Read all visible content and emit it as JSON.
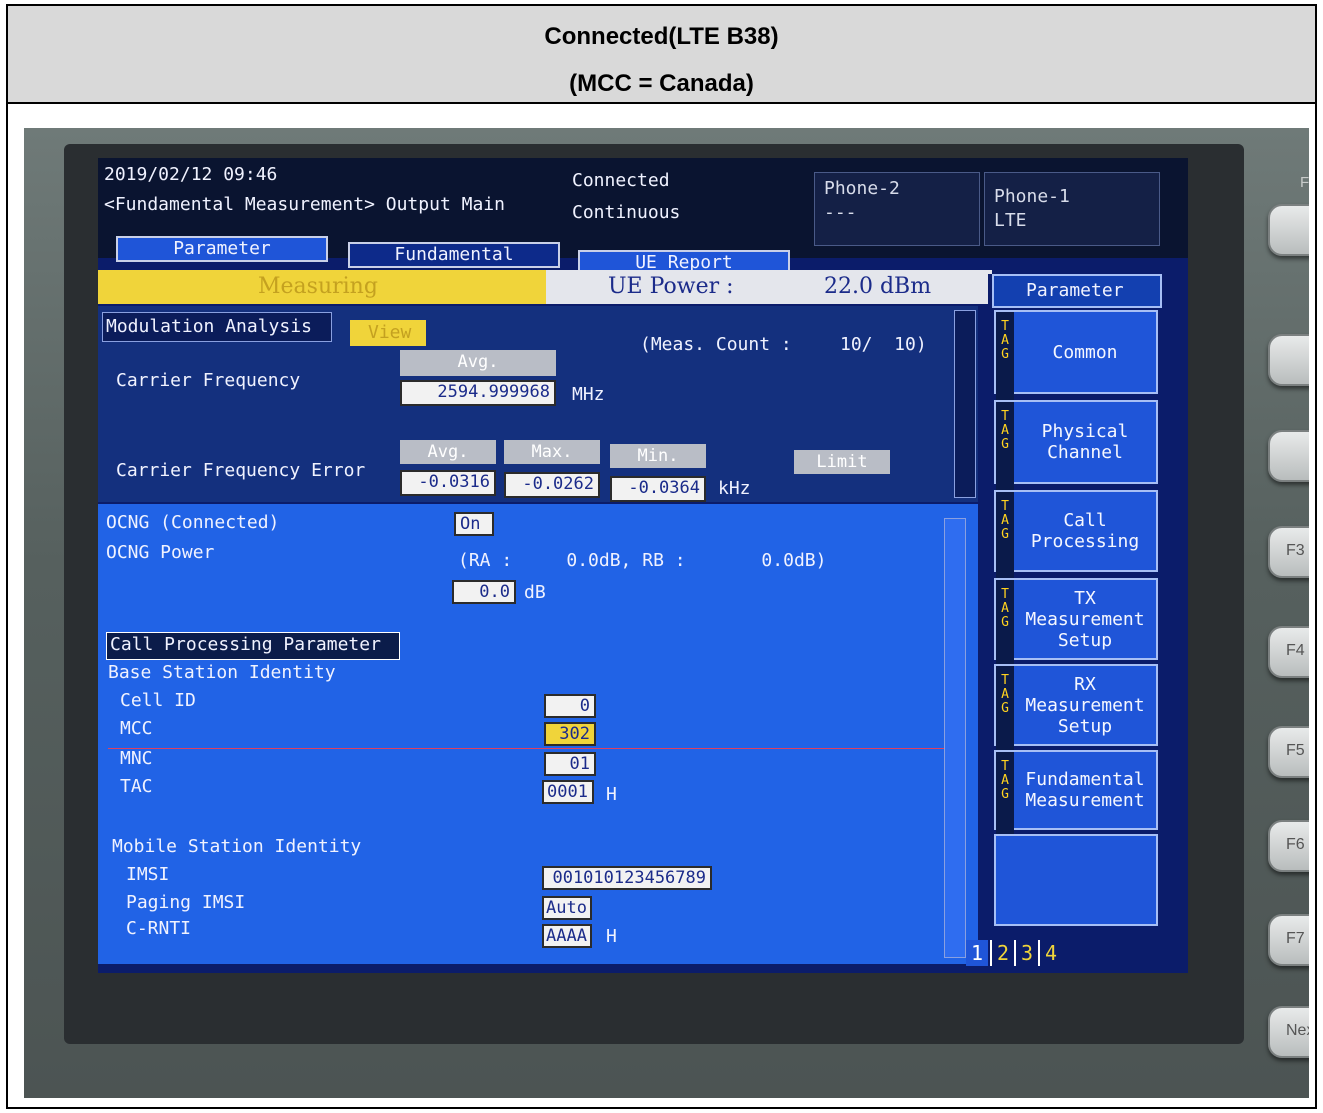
{
  "caption": {
    "title": "Connected(LTE B38)",
    "subtitle": "(MCC = Canada)"
  },
  "screen": {
    "datetime": "2019/02/12 09:46",
    "mode": "<Fundamental Measurement> Output Main",
    "call_status": "Connected",
    "sweep": "Continuous",
    "phone2": {
      "label": "Phone-2",
      "status": "---"
    },
    "phone1": {
      "label": "Phone-1",
      "status": "LTE"
    },
    "tabs": [
      "Parameter",
      "Fundamental",
      "UE Report"
    ],
    "measuring": "Measuring",
    "ue_power": {
      "label": "UE Power :",
      "value": "22.0 dBm"
    },
    "modulation_title": "Modulation Analysis",
    "view_button": "View",
    "meas_count": "(Meas. Count :",
    "meas_count_value": "10/  10)",
    "carrier_freq": {
      "label": "Carrier Frequency",
      "avg_label": "Avg.",
      "value": "2594.999968",
      "unit": "MHz"
    },
    "carrier_err": {
      "label": "Carrier Frequency Error",
      "avg_label": "Avg.",
      "max_label": "Max.",
      "min_label": "Min.",
      "avg": "-0.0316",
      "max": "-0.0262",
      "min": "-0.0364",
      "unit": "kHz",
      "limit_button": "Limit"
    },
    "ocng": {
      "label": "OCNG (Connected)",
      "value": "On",
      "power_label": "OCNG Power",
      "power_detail": "(RA :     0.0dB, RB :       0.0dB)",
      "power_value": "0.0",
      "power_unit": "dB"
    },
    "call_proc_header": "Call Processing Parameter",
    "bs_identity": "Base Station Identity",
    "cell_id": {
      "label": "Cell ID",
      "value": "0"
    },
    "mcc": {
      "label": "MCC",
      "value": "302"
    },
    "mnc": {
      "label": "MNC",
      "value": "01"
    },
    "tac": {
      "label": "TAC",
      "value": "0001",
      "unit": "H"
    },
    "ms_identity": "Mobile Station Identity",
    "imsi": {
      "label": "IMSI",
      "value": "001010123456789"
    },
    "paging_imsi": {
      "label": "Paging IMSI",
      "value": "Auto"
    },
    "crnti": {
      "label": "C-RNTI",
      "value": "AAAA",
      "unit": "H"
    },
    "side_title": "Parameter",
    "side_tag": "T\nA\nG",
    "side_buttons": [
      "Common",
      "Physical\nChannel",
      "Call\nProcessing",
      "TX\nMeasurement\nSetup",
      "RX\nMeasurement\nSetup",
      "Fundamental\nMeasurement",
      ""
    ],
    "pages": [
      "1",
      "2",
      "3",
      "4"
    ]
  },
  "keys": {
    "fun": "Fun",
    "f3": "F3",
    "f4": "F4",
    "f5": "F5",
    "f6": "F6",
    "f7": "F7",
    "next": "Next"
  },
  "colors": {
    "screen_bg": "#0b1c6a",
    "panel_blue": "#1f55d8",
    "highlight": "#f0d43a",
    "header_bg": "#0a1430"
  }
}
